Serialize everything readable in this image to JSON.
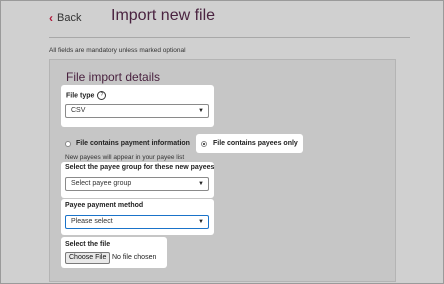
{
  "header": {
    "back_label": "Back",
    "back_icon": "chevron-left-icon",
    "title": "Import new file"
  },
  "mandatory_note": "All fields are mandatory unless marked  optional",
  "form": {
    "section_title": "File import details",
    "file_type": {
      "label": "File type",
      "help_glyph": "?",
      "value": "CSV"
    },
    "content_options": {
      "option_payment_info": "File contains payment information",
      "option_payees_only": "File contains payees only",
      "selected": "payees_only"
    },
    "new_payees_note": "New payees will appear in your payee list",
    "payee_group": {
      "label": "Select the payee group for these new payees",
      "value": "Select payee group"
    },
    "payment_method": {
      "label": "Payee payment method",
      "value": "Please select"
    },
    "file_select": {
      "label": "Select the file",
      "button": "Choose File",
      "status": "No file chosen"
    }
  },
  "colors": {
    "accent": "#b0183a",
    "title": "#4a2340",
    "focus_border": "#1a73c9",
    "highlight": "#ffffff"
  }
}
